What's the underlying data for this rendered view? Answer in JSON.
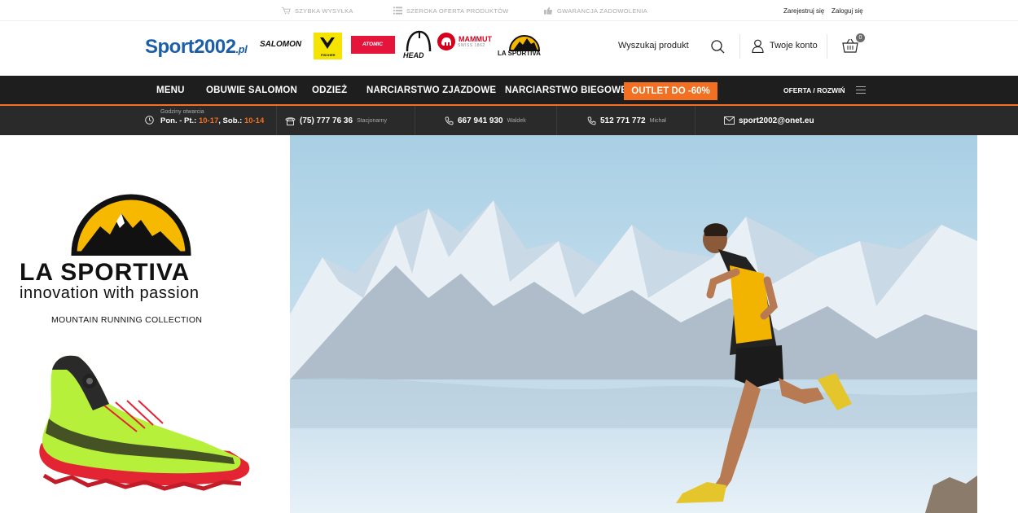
{
  "topbar": {
    "perks": [
      {
        "label": "SZYBKA WYSYŁKA",
        "icon": "cart-icon"
      },
      {
        "label": "SZEROKA OFERTA PRODUKTÓW",
        "icon": "list-icon"
      },
      {
        "label": "GWARANCJA ZADOWOLENIA",
        "icon": "thumbs-up-icon"
      }
    ],
    "register": "Zarejestruj się",
    "login": "Zaloguj się"
  },
  "header": {
    "logo": {
      "part1": "Sport",
      "part2": "2002",
      "part3": ".pl"
    },
    "brands": [
      "SALOMON",
      "FISCHER",
      "ATOMIC",
      "HEAD",
      "MAMMUT",
      "LA SPORTIVA"
    ],
    "search_label": "Wyszukaj produkt",
    "account_label": "Twoje konto",
    "cart_count": "0"
  },
  "nav": {
    "items": [
      "MENU",
      "OBUWIE SALOMON",
      "ODZIEŻ",
      "NARCIARSTWO ZJAZDOWE",
      "NARCIARSTWO BIEGOWE"
    ],
    "outlet": "OUTLET DO -60%",
    "offer": "OFERTA / ROZWIŃ"
  },
  "contact": {
    "hours_label": "Godziny otwarcia",
    "hours_a": "Pon. - Pt.: ",
    "hours_b": "10-17",
    "hours_c": ", Sob.: ",
    "hours_d": "10-14",
    "phone1": "(75) 777 76 36",
    "phone1_note": "Stacjonarny",
    "phone2": "667 941 930",
    "phone2_note": "Waldek",
    "phone3": "512 771 772",
    "phone3_note": "Michał",
    "email": "sport2002@onet.eu"
  },
  "hero": {
    "brand": "LA SPORTIVA",
    "tagline": "innovation with passion",
    "collection": "MOUNTAIN RUNNING COLLECTION"
  },
  "colors": {
    "accent": "#f36f21",
    "nav_bg": "#1e1e1e",
    "logo_blue": "#1c5fa8"
  }
}
